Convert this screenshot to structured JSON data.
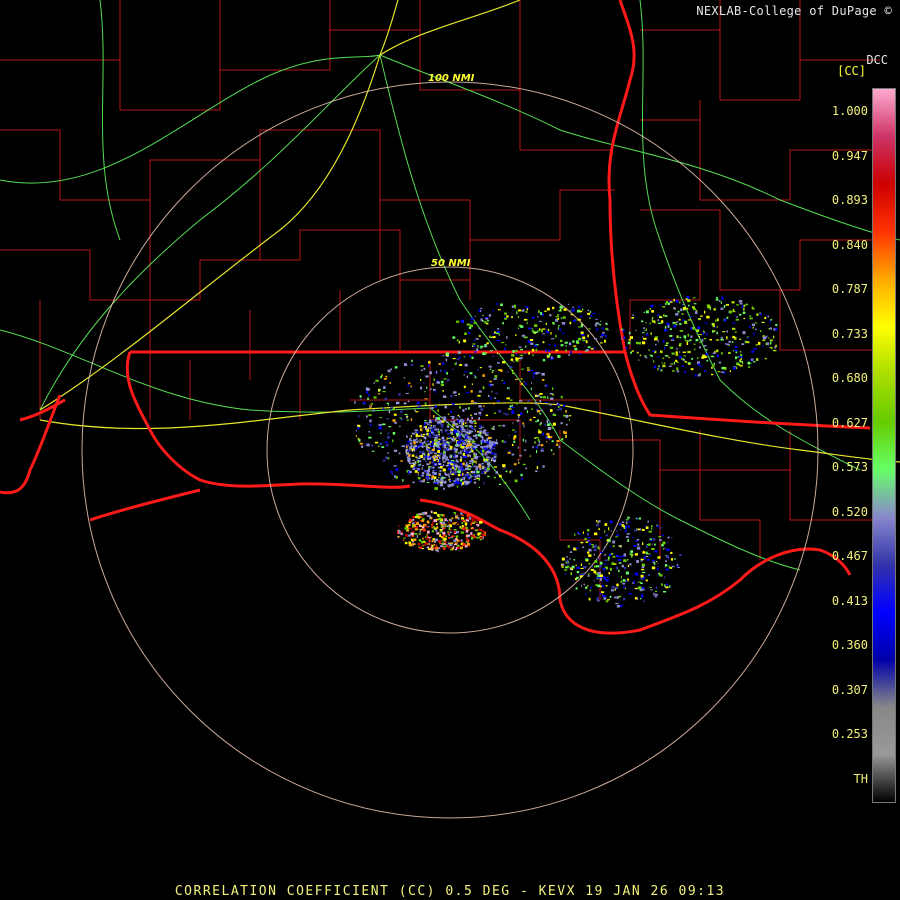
{
  "credit": "NEXLAB-College of DuPage ©",
  "station_tag": "DCC",
  "legend": {
    "unit": "[CC]",
    "ticks": [
      "1.000",
      "0.947",
      "0.893",
      "0.840",
      "0.787",
      "0.733",
      "0.680",
      "0.627",
      "0.573",
      "0.520",
      "0.467",
      "0.413",
      "0.360",
      "0.307",
      "0.253",
      "TH"
    ],
    "stops": [
      "#ffaad0",
      "#cc3366",
      "#cc0000",
      "#ff3300",
      "#ffaa00",
      "#ffff00",
      "#aadd00",
      "#66cc00",
      "#66ff66",
      "#8888cc",
      "#3333aa",
      "#0000ff",
      "#0000aa",
      "#888888",
      "#999999",
      "#000000"
    ]
  },
  "ring_labels": {
    "outer": "100 NMI",
    "inner": "50 NMI"
  },
  "footer": "CORRELATION COEFFICIENT (CC) 0.5 DEG - KEVX 19 JAN 26 09:13",
  "colors": {
    "state_border": "#ff1a1a",
    "county": "#c01818",
    "highway": "#55dd55",
    "interstate": "#ffff33",
    "range_ring": "#f0c8b4"
  }
}
